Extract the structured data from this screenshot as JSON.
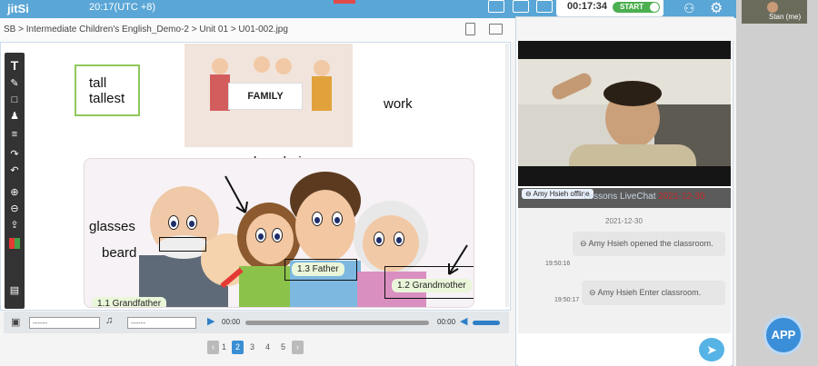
{
  "topbar": {
    "logo": "jitSi",
    "clock": "20:17(UTC +8)",
    "timer": "00:17:34",
    "start_label": "START"
  },
  "breadcrumb": "SB > Intermediate Children's English_Demo-2 > Unit 01 > U01-002.jpg",
  "slide": {
    "words": [
      "tall",
      "tallest"
    ],
    "family_sign": "FAMILY",
    "work": "work",
    "long_hair": "long hair",
    "glasses": "glasses",
    "beard": "beard",
    "labels": {
      "father": "1.3 Father",
      "grandmother": "1.2 Grandmother",
      "grandfather": "1.1 Grandfather"
    }
  },
  "media": {
    "select1": "------",
    "select2": "------",
    "time_left": "00:00",
    "time_right": "00:00"
  },
  "pager": {
    "pages": [
      "1",
      "2",
      "3",
      "4",
      "5"
    ],
    "active": "2"
  },
  "user_thumb": {
    "name": "Stan (me)"
  },
  "chat": {
    "offline_tag": "⊖ Amy Hsieh offline",
    "title": "Lessons LiveChat",
    "date": "2021-12-30",
    "day": "2021-12-30",
    "messages": [
      {
        "time": "19:50:16",
        "text": "⊖ Amy Hsieh opened the classroom."
      },
      {
        "time": "19:50:17",
        "text": "⊖ Amy Hsieh Enter classroom."
      }
    ]
  },
  "app_button": "APP",
  "colors": {
    "accent": "#5aa6d6",
    "start_green": "#4caf50",
    "chat_date_red": "#c62828",
    "app_blue": "#3b8ed8"
  },
  "icons": [
    "text-tool-icon",
    "pen-icon",
    "square-icon",
    "stamp-icon",
    "lines-icon",
    "redo-icon",
    "undo-icon",
    "zoom-in-icon",
    "zoom-out-icon",
    "share-icon",
    "palette-icon",
    "subtitle-icon",
    "send-icon",
    "gear-icon"
  ]
}
